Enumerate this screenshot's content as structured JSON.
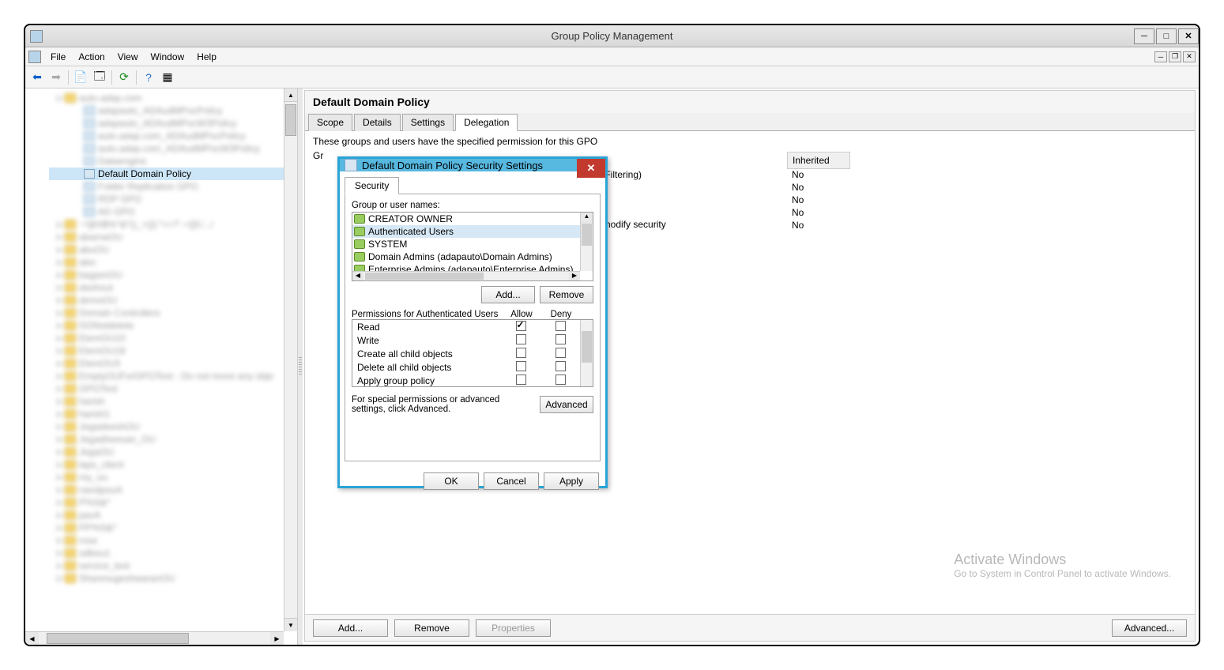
{
  "window": {
    "title": "Group Policy Management"
  },
  "menus": {
    "file": "File",
    "action": "Action",
    "view": "View",
    "window": "Window",
    "help": "Help"
  },
  "tree": {
    "selected": "Default Domain Policy"
  },
  "rightPane": {
    "title": "Default Domain Policy",
    "tabs": {
      "scope": "Scope",
      "details": "Details",
      "settings": "Settings",
      "delegation": "Delegation"
    },
    "delegationDesc": "These groups and users have the specified permission for this GPO",
    "cols": {
      "inherited": "Inherited"
    },
    "inheritedRows": [
      "No",
      "No",
      "No",
      "No",
      "No"
    ],
    "permissionVisible": "y Filtering)",
    "midRowPerm": ", modify security",
    "buttons": {
      "add": "Add...",
      "remove": "Remove",
      "properties": "Properties",
      "advanced": "Advanced..."
    }
  },
  "dialog": {
    "title": "Default Domain Policy Security Settings",
    "tab": "Security",
    "groupLabel": "Group or user names:",
    "groups": [
      "CREATOR OWNER",
      "Authenticated Users",
      "SYSTEM",
      "Domain Admins (adapauto\\Domain Admins)",
      "Enterprise Admins (adapauto\\Enterprise Admins)"
    ],
    "add": "Add...",
    "remove": "Remove",
    "permLabel": "Permissions for Authenticated Users",
    "allow": "Allow",
    "deny": "Deny",
    "perms": [
      {
        "name": "Read",
        "allow": true,
        "deny": false
      },
      {
        "name": "Write",
        "allow": false,
        "deny": false
      },
      {
        "name": "Create all child objects",
        "allow": false,
        "deny": false
      },
      {
        "name": "Delete all child objects",
        "allow": false,
        "deny": false
      },
      {
        "name": "Apply group policy",
        "allow": false,
        "deny": false
      }
    ],
    "advText": "For special permissions or advanced settings, click Advanced.",
    "advanced": "Advanced",
    "ok": "OK",
    "cancel": "Cancel",
    "apply": "Apply"
  },
  "watermark": {
    "title": "Activate Windows",
    "sub": "Go to System in Control Panel to activate Windows."
  }
}
